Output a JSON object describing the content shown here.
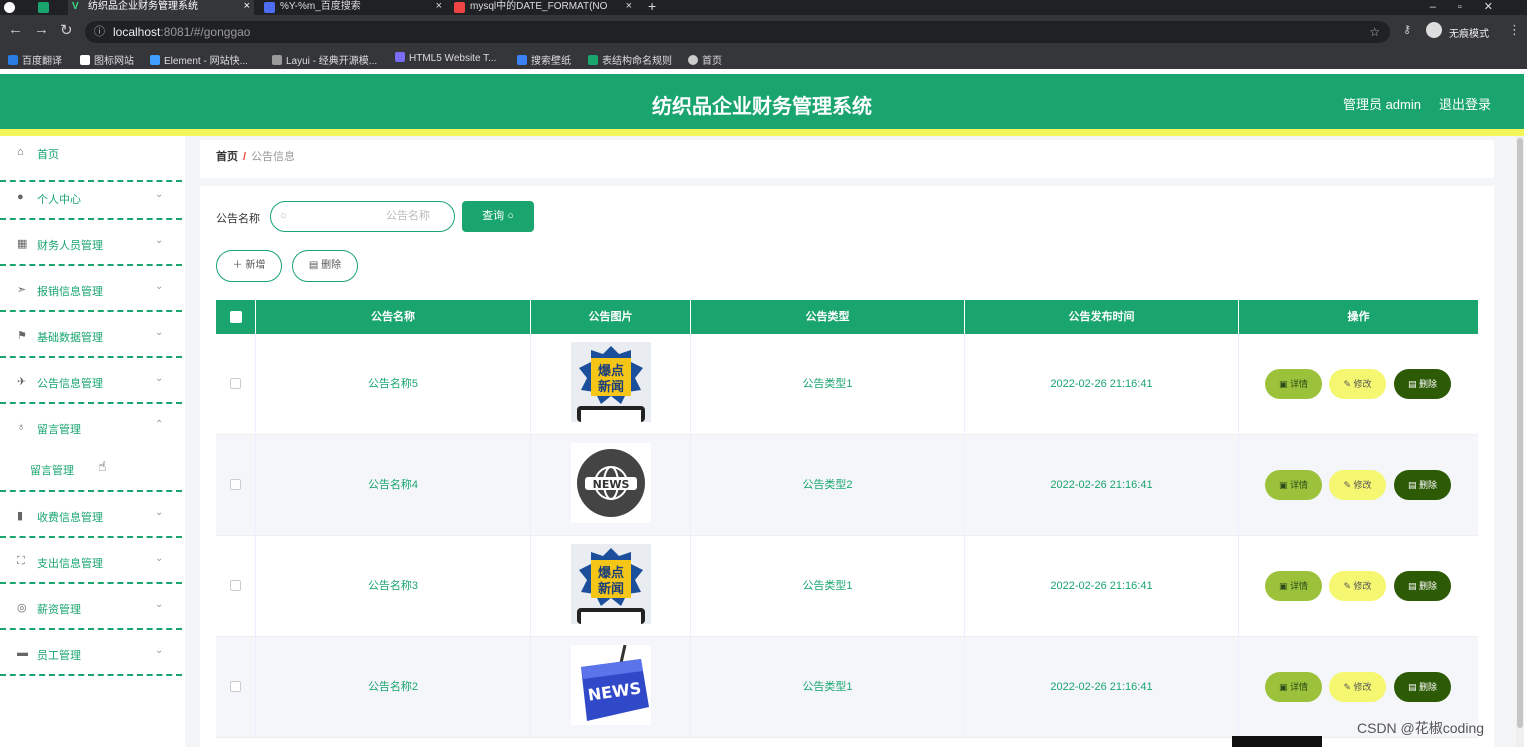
{
  "browser": {
    "tabs": [
      {
        "label": "",
        "favicon": "globe-icon",
        "color": "#fff"
      },
      {
        "label": "",
        "favicon": "sheet-icon",
        "color": "#1aa56e"
      },
      {
        "label": "纺织品企业财务管理系统",
        "favicon": "vue-icon",
        "color": "#3ddc84"
      },
      {
        "label": "%Y-%m_百度搜索",
        "favicon": "baidu-icon",
        "color": "#4e6ef2"
      },
      {
        "label": "mysql中的DATE_FORMAT(NO",
        "favicon": "csdn-icon",
        "color": "#e44"
      }
    ],
    "new_tab": "+",
    "close": "×",
    "url_host": "localhost",
    "url_path": ":8081/#/gonggao",
    "incognito": "无痕模式",
    "bookmarks": [
      {
        "label": "百度翻译",
        "color": "#2a7de1"
      },
      {
        "label": "图标网站",
        "color": "#fff"
      },
      {
        "label": "Element - 网站快...",
        "color": "#409eff"
      },
      {
        "label": "Layui - 经典开源模...",
        "color": "#999"
      },
      {
        "label": "HTML5 Website T...",
        "color": "#7b6cf6"
      },
      {
        "label": "搜索壁纸",
        "color": "#3b82f6"
      },
      {
        "label": "表结构命名规则",
        "color": "#1aa56e"
      },
      {
        "label": "首页",
        "color": "#ccc"
      }
    ]
  },
  "header": {
    "title": "纺织品企业财务管理系统",
    "user": "管理员 admin",
    "logout": "退出登录"
  },
  "sidebar": [
    {
      "label": "首页",
      "icon": "home-icon"
    },
    {
      "label": "个人中心",
      "icon": "user-icon"
    },
    {
      "label": "财务人员管理",
      "icon": "grid-icon"
    },
    {
      "label": "报销信息管理",
      "icon": "send-icon"
    },
    {
      "label": "基础数据管理",
      "icon": "flag-icon"
    },
    {
      "label": "公告信息管理",
      "icon": "plane-icon"
    },
    {
      "label": "留言管理",
      "icon": "mic-icon"
    },
    {
      "label": "留言管理",
      "icon": ""
    },
    {
      "label": "收费信息管理",
      "icon": "chart-icon"
    },
    {
      "label": "支出信息管理",
      "icon": "frame-icon"
    },
    {
      "label": "薪资管理",
      "icon": "coin-icon"
    },
    {
      "label": "员工管理",
      "icon": "monitor-icon"
    }
  ],
  "breadcrumb": {
    "home": "首页",
    "sep": "/",
    "current": "公告信息"
  },
  "search": {
    "label": "公告名称",
    "placeholder": "公告名称",
    "button": "查询"
  },
  "actions": {
    "add": "新增",
    "delete": "删除"
  },
  "table": {
    "columns": [
      "公告名称",
      "公告图片",
      "公告类型",
      "公告发布时间",
      "操作"
    ],
    "rows": [
      {
        "name": "公告名称5",
        "image": "burst-news",
        "type": "公告类型1",
        "time": "2022-02-26 21:16:41"
      },
      {
        "name": "公告名称4",
        "image": "globe-news",
        "type": "公告类型2",
        "time": "2022-02-26 21:16:41"
      },
      {
        "name": "公告名称3",
        "image": "burst-news",
        "type": "公告类型1",
        "time": "2022-02-26 21:16:41"
      },
      {
        "name": "公告名称2",
        "image": "key-news",
        "type": "公告类型1",
        "time": "2022-02-26 21:16:41"
      }
    ],
    "row_actions": {
      "detail": "详情",
      "edit": "修改",
      "delete": "删除"
    }
  },
  "image_texts": {
    "burst_top": "爆点",
    "burst_bottom": "新闻",
    "globe": "NEWS",
    "key": "NEWS"
  },
  "watermark": "CSDN @花椒coding",
  "colors": {
    "primary": "#1aa56e",
    "strip": "#f3f65a",
    "detail": "#9cc13a",
    "edit": "#f5f770",
    "delete": "#2d5a05"
  }
}
